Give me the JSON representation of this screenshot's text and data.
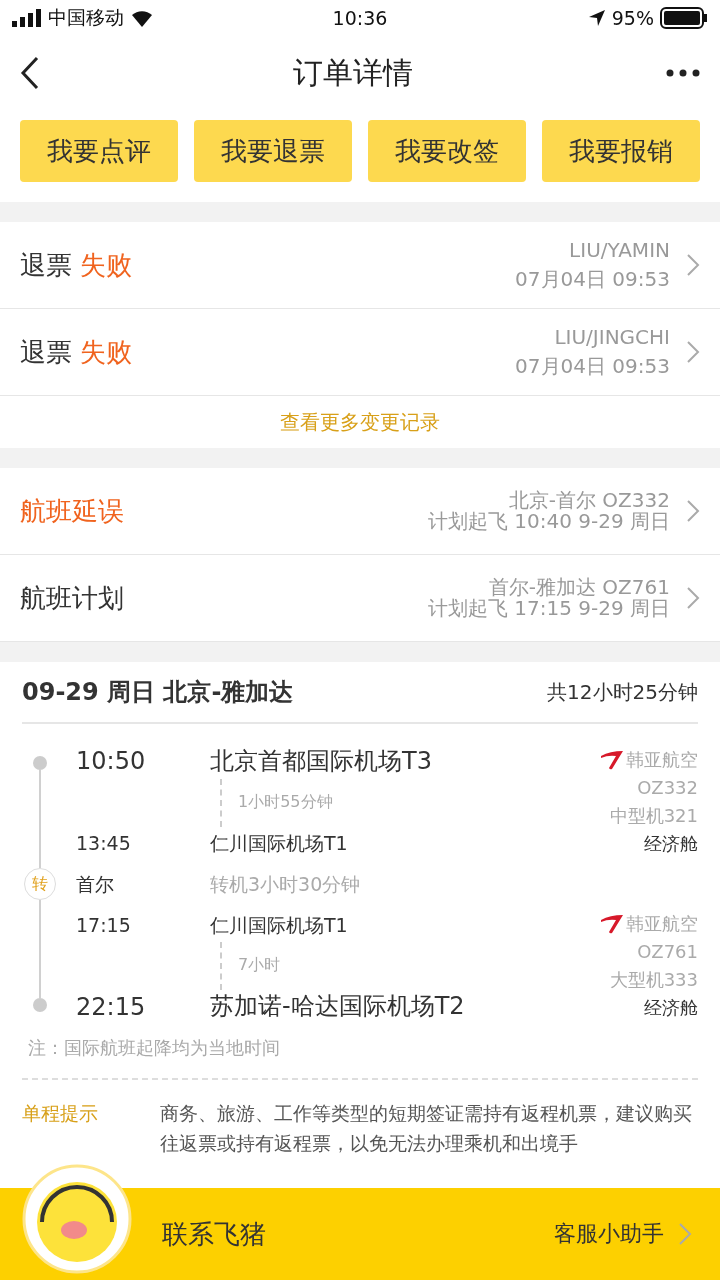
{
  "status_bar": {
    "carrier": "中国移动",
    "time": "10:36",
    "battery": "95%"
  },
  "nav": {
    "title": "订单详情"
  },
  "actions": [
    "我要点评",
    "我要退票",
    "我要改签",
    "我要报销"
  ],
  "refunds": [
    {
      "type": "退票",
      "status": "失败",
      "passenger": "LIU/YAMIN",
      "time": "07月04日 09:53"
    },
    {
      "type": "退票",
      "status": "失败",
      "passenger": "LIU/JINGCHI",
      "time": "07月04日 09:53"
    }
  ],
  "more_link": "查看更多变更记录",
  "flight_status": [
    {
      "kind": "delayed",
      "label": "航班延误",
      "route": "北京-首尔 OZ332",
      "plan": "计划起飞 10:40 9-29 周日"
    },
    {
      "kind": "plan",
      "label": "航班计划",
      "route": "首尔-雅加达 OZ761",
      "plan": "计划起飞 17:15 9-29 周日"
    }
  ],
  "itinerary": {
    "title": "09-29 周日 北京-雅加达",
    "total": "共12小时25分钟",
    "segments": [
      {
        "dep_time": "10:50",
        "dep_airport": "北京首都国际机场T3",
        "duration": "1小时55分钟",
        "arr_time": "13:45",
        "arr_airport": "仁川国际机场T1",
        "airline": "韩亚航空",
        "flight_no": "OZ332",
        "aircraft": "中型机321",
        "cabin": "经济舱"
      },
      {
        "dep_time": "17:15",
        "dep_airport": "仁川国际机场T1",
        "duration": "7小时",
        "arr_time": "22:15",
        "arr_airport": "苏加诺-哈达国际机场T2",
        "airline": "韩亚航空",
        "flight_no": "OZ761",
        "aircraft": "大型机333",
        "cabin": "经济舱"
      }
    ],
    "transfer": {
      "badge": "转",
      "city": "首尔",
      "text": "转机3小时30分钟"
    },
    "note": "注：国际航班起降均为当地时间"
  },
  "tip": {
    "label": "单程提示",
    "text": "商务、旅游、工作等类型的短期签证需持有返程机票，建议购买往返票或持有返程票，以免无法办理乘机和出境手"
  },
  "bottom_bar": {
    "title": "联系飞猪",
    "link": "客服小助手"
  }
}
